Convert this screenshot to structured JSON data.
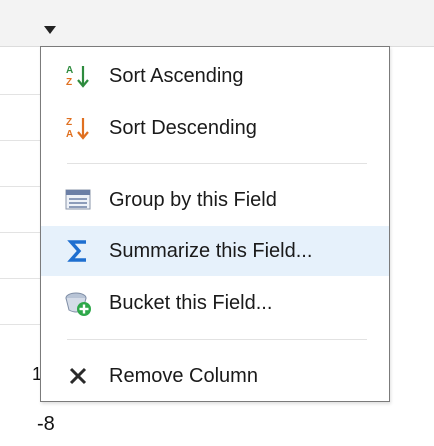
{
  "menu": {
    "items": [
      {
        "label": "Sort Ascending",
        "icon": "sort-ascending-icon"
      },
      {
        "label": "Sort Descending",
        "icon": "sort-descending-icon"
      },
      {
        "label": "Group by this Field",
        "icon": "group-by-icon"
      },
      {
        "label": "Summarize this Field...",
        "icon": "sum-icon",
        "highlighted": true
      },
      {
        "label": "Bucket this Field...",
        "icon": "bucket-icon"
      },
      {
        "label": "Remove Column",
        "icon": "close-icon"
      }
    ],
    "highlight_color": "#e6f1fb",
    "border_color": "#7b7b7b"
  },
  "sheet": {
    "visible_cell_value": "-8",
    "partial_cell_text": "1"
  },
  "colors": {
    "sort_arrow_orange": "#e07020",
    "sort_arrow_green": "#2e8b3e",
    "sum_blue": "#1e6fd0",
    "bucket_green": "#2ea84a"
  }
}
